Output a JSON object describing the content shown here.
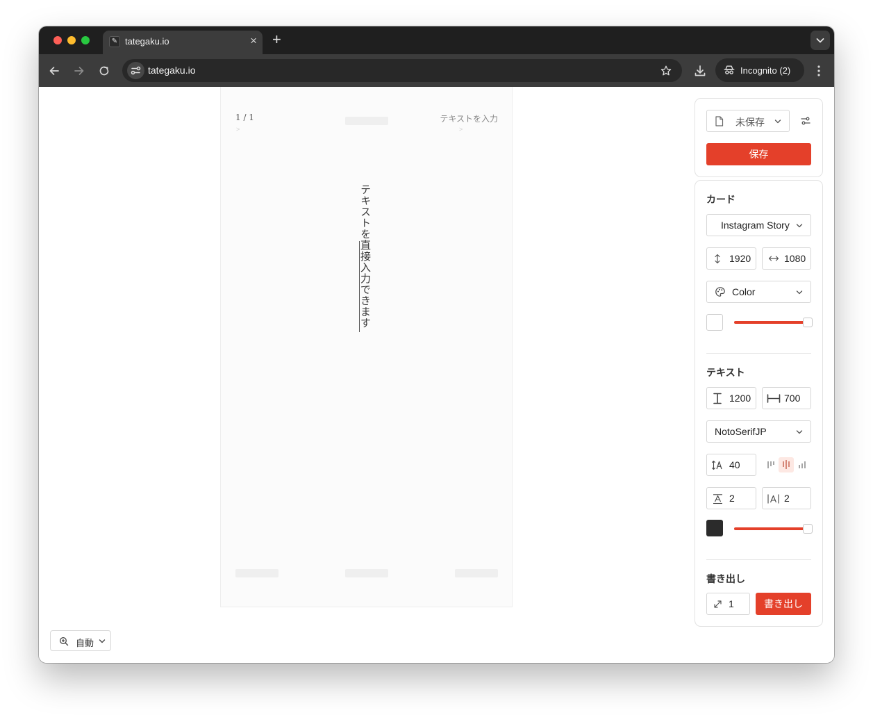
{
  "browser": {
    "tab_title": "tategaku.io",
    "tab_favicon": "feather-icon",
    "url": "tategaku.io",
    "incognito_label": "Incognito (2)"
  },
  "preview": {
    "page_count": "1 / 1",
    "placeholder_hint": "テキストを入力",
    "hint_marker": ">",
    "body_text": "テキストを直接入力できます"
  },
  "zoom": {
    "label": "自動"
  },
  "file": {
    "status": "未保存",
    "save_label": "保存"
  },
  "card": {
    "title": "カード",
    "preset": "Instagram Story",
    "height": "1920",
    "width": "1080",
    "fill_mode": "Color",
    "background_color": "#ffffff",
    "opacity_fraction": 1.0
  },
  "text": {
    "title": "テキスト",
    "height": "1200",
    "width": "700",
    "font": "NotoSerifJP",
    "font_size": "40",
    "alignment_options": [
      "top",
      "center",
      "bottom"
    ],
    "alignment_selected": "center",
    "line_spacing": "2",
    "letter_spacing": "2",
    "text_color": "#2b2b2b",
    "opacity_fraction": 1.0
  },
  "export": {
    "title": "書き出し",
    "scale": "1",
    "button_label": "書き出し"
  },
  "colors": {
    "accent": "#e4402a",
    "chrome_dark": "#1f1f1f",
    "chrome_toolbar": "#3c3c3c"
  }
}
